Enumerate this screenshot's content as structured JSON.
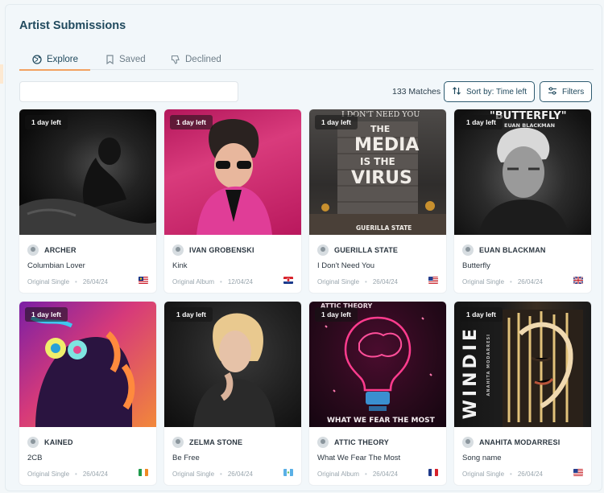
{
  "page": {
    "title": "Artist Submissions"
  },
  "tabs": [
    {
      "label": "Explore",
      "icon": "globe-icon",
      "active": true
    },
    {
      "label": "Saved",
      "icon": "bookmark-icon",
      "active": false
    },
    {
      "label": "Declined",
      "icon": "thumbs-down-icon",
      "active": false
    }
  ],
  "toolbar": {
    "search_value": "",
    "matches": "133 Matches",
    "sort_label": "Sort by: Time left",
    "filters_label": "Filters"
  },
  "cards": [
    {
      "badge": "1 day left",
      "artist": "ARCHER",
      "song": "Columbian Lover",
      "type": "Original Single",
      "date": "26/04/24",
      "flag": "flag-malaysia",
      "art_text": ""
    },
    {
      "badge": "1 day left",
      "artist": "IVAN GROBENSKI",
      "song": "Kink",
      "type": "Original Album",
      "date": "12/04/24",
      "flag": "flag-croatia",
      "art_text": ""
    },
    {
      "badge": "1 day left",
      "artist": "GUERILLA STATE",
      "song": "I Don't Need You",
      "type": "Original Single",
      "date": "26/04/24",
      "flag": "flag-usa",
      "art_text": "I DON'T NEED YOU"
    },
    {
      "badge": "1 day left",
      "artist": "EUAN BLACKMAN",
      "song": "Butterfly",
      "type": "Original Single",
      "date": "26/04/24",
      "flag": "flag-uk",
      "art_text": "\"BUTTERFLY\""
    },
    {
      "badge": "1 day left",
      "artist": "KAINED",
      "song": "2CB",
      "type": "Original Single",
      "date": "26/04/24",
      "flag": "flag-ireland",
      "art_text": ""
    },
    {
      "badge": "1 day left",
      "artist": "ZELMA STONE",
      "song": "Be Free",
      "type": "Original Single",
      "date": "26/04/24",
      "flag": "flag-guatemala",
      "art_text": ""
    },
    {
      "badge": "1 day left",
      "artist": "ATTIC THEORY",
      "song": "What We Fear The Most",
      "type": "Original Album",
      "date": "26/04/24",
      "flag": "flag-france",
      "art_text": "WHAT WE FEAR THE MOST"
    },
    {
      "badge": "1 day left",
      "artist": "ANAHITA MODARRESI",
      "song": "Song name",
      "type": "Original Single",
      "date": "26/04/24",
      "flag": "flag-usa",
      "art_text": "WINDIE"
    }
  ],
  "art_extra": {
    "media_line1": "THE",
    "media_line2": "MEDIA",
    "media_line3": "IS THE",
    "media_line4": "VIRUS",
    "media_bottom": "GUERILLA STATE",
    "butterfly_sub": "EUAN BLACKMAN",
    "attic_top": "ATTIC THEORY",
    "windie_vertical": "ANAHITA MODARRESI"
  }
}
